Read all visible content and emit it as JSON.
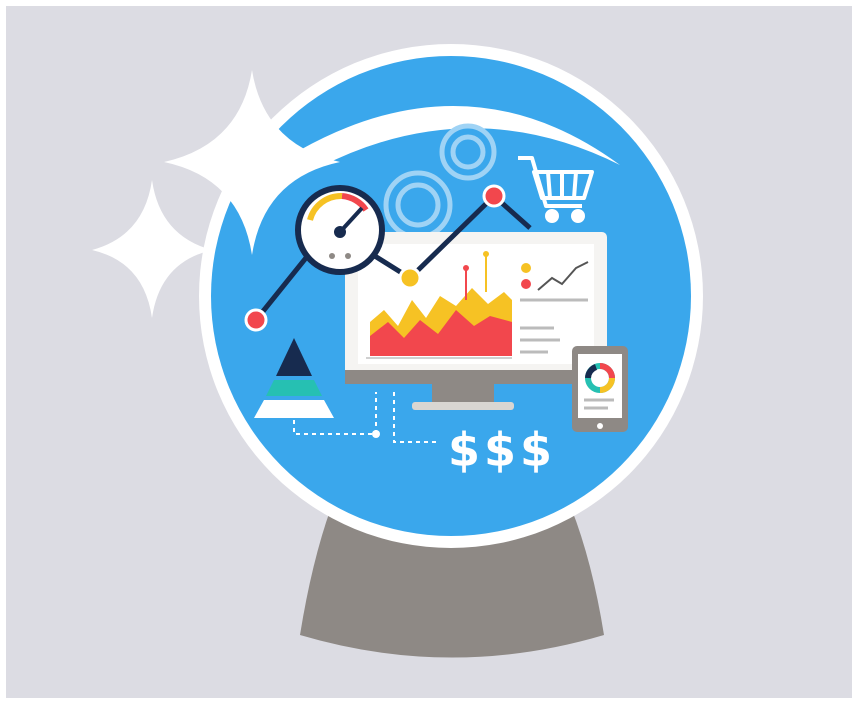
{
  "illustration": {
    "dollar_signs": [
      "$",
      "$",
      "$"
    ],
    "icons": [
      "crystal-ball",
      "sparkle",
      "gauge",
      "gear",
      "shopping-cart",
      "monitor",
      "area-chart",
      "tablet",
      "donut-chart",
      "pyramid",
      "line-graph"
    ]
  },
  "colors": {
    "background": "#dcdce3",
    "globe": "#3aa7ec",
    "globe_rim": "#ffffff",
    "stand": "#8e8985",
    "navy": "#172b4f",
    "red": "#f2474d",
    "yellow": "#f6c224",
    "teal": "#26c0b2",
    "gear": "#9fd3f5"
  }
}
